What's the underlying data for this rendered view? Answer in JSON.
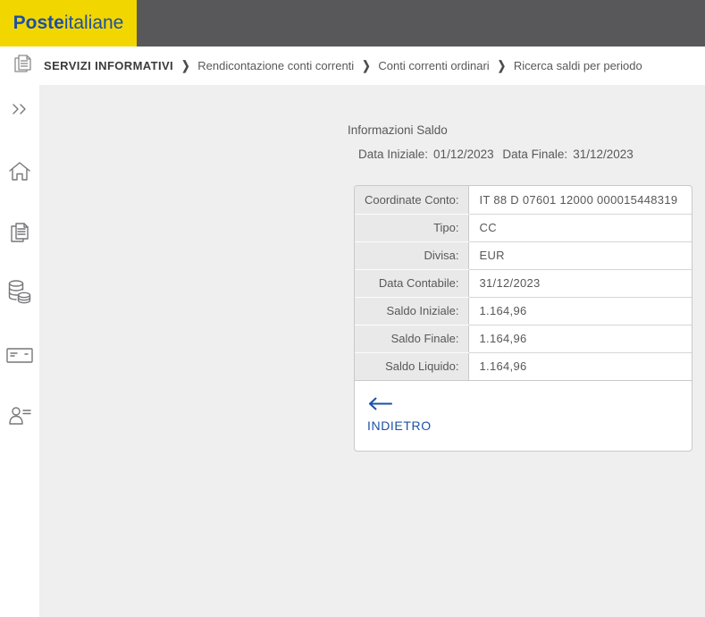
{
  "header": {
    "logo_bold": "Poste",
    "logo_regular": "italiane"
  },
  "breadcrumb": {
    "items": [
      {
        "label": "SERVIZI INFORMATIVI"
      },
      {
        "label": "Rendicontazione conti correnti"
      },
      {
        "label": "Conti correnti ordinari"
      },
      {
        "label": "Ricerca saldi per periodo"
      }
    ],
    "separator": "❯"
  },
  "sidebar": {
    "items": [
      {
        "icon": "expand-double-chevron"
      },
      {
        "icon": "home"
      },
      {
        "icon": "documents"
      },
      {
        "icon": "coins"
      },
      {
        "icon": "cheque"
      },
      {
        "icon": "user-profile"
      }
    ]
  },
  "main": {
    "section_title": "Informazioni Saldo",
    "data_iniziale_label": "Data Iniziale:",
    "data_iniziale_value": "01/12/2023",
    "data_finale_label": "Data Finale:",
    "data_finale_value": "31/12/2023",
    "table": {
      "rows": [
        {
          "label": "Coordinate Conto:",
          "value": "IT 88 D 07601  12000  000015448319"
        },
        {
          "label": "Tipo:",
          "value": "CC"
        },
        {
          "label": "Divisa:",
          "value": "EUR"
        },
        {
          "label": "Data Contabile:",
          "value": "31/12/2023"
        },
        {
          "label": "Saldo Iniziale:",
          "value": "1.164,96"
        },
        {
          "label": "Saldo Finale:",
          "value": "1.164,96"
        },
        {
          "label": "Saldo Liquido:",
          "value": "1.164,96"
        }
      ]
    },
    "back_button": {
      "label": "INDIETRO"
    }
  },
  "colors": {
    "brand_yellow": "#f2d600",
    "brand_blue": "#1d50a5",
    "header_gray": "#58585a",
    "content_bg": "#f0eff0",
    "table_label_bg": "#e9e9e9"
  }
}
